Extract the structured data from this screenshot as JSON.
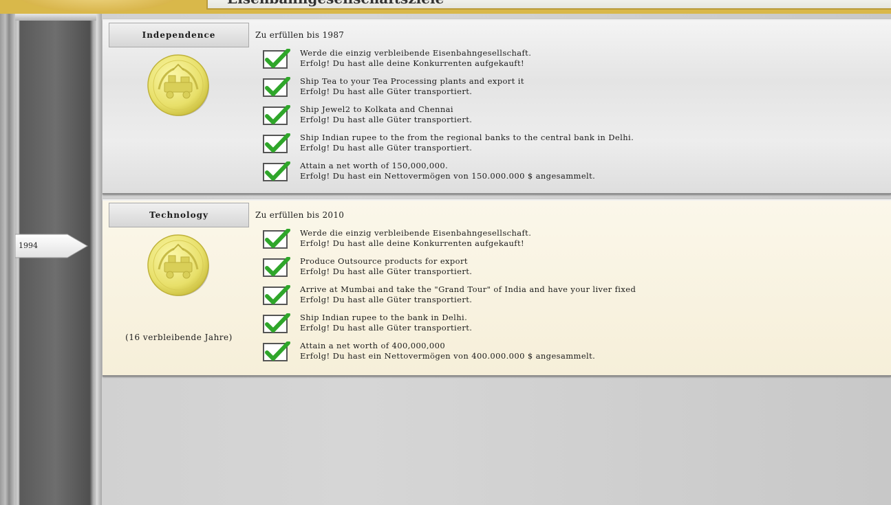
{
  "header": {
    "title": "Eisenbahngesellschaftsziele"
  },
  "timeline": {
    "current_year": "1994"
  },
  "milestones": [
    {
      "name": "Independence",
      "deadline": "Zu erfüllen bis 1987",
      "remaining": "",
      "goals": [
        {
          "title": "Werde die einzig verbleibende Eisenbahngesellschaft.",
          "status": "Erfolg! Du hast alle deine Konkurrenten aufgekauft!"
        },
        {
          "title": "Ship Tea to your Tea Processing  plants and export it",
          "status": "Erfolg! Du hast alle Güter transportiert."
        },
        {
          "title": "Ship Jewel2 to  Kolkata and Chennai",
          "status": "Erfolg! Du hast alle Güter transportiert."
        },
        {
          "title": "Ship Indian rupee to the from the regional banks to the central bank in Delhi.",
          "status": "Erfolg! Du hast alle Güter transportiert."
        },
        {
          "title": "Attain a net worth of 150,000,000.",
          "status": "Erfolg! Du hast ein Nettovermögen von 150.000.000 $ angesammelt."
        }
      ]
    },
    {
      "name": "Technology",
      "deadline": "Zu erfüllen bis 2010",
      "remaining": "(16 verbleibende Jahre)",
      "goals": [
        {
          "title": "Werde die einzig verbleibende Eisenbahngesellschaft.",
          "status": "Erfolg! Du hast alle deine Konkurrenten aufgekauft!"
        },
        {
          "title": "Produce Outsource products for export",
          "status": "Erfolg! Du hast alle Güter transportiert."
        },
        {
          "title": "Arrive at Mumbai and take the \"Grand Tour\" of India and have your liver fixed",
          "status": "Erfolg! Du hast alle Güter transportiert."
        },
        {
          "title": "Ship Indian rupee to the bank in Delhi.",
          "status": "Erfolg! Du hast alle Güter transportiert."
        },
        {
          "title": "Attain a net worth of 400,000,000",
          "status": "Erfolg! Du hast ein Nettovermögen von 400.000.000 $ angesammelt."
        }
      ]
    }
  ],
  "icons": {
    "medal": "gold-train-medal-icon",
    "check": "green-checkmark-icon"
  },
  "colors": {
    "gold": "#e8e06a",
    "check_green": "#2fa62a",
    "cream_panel": "#f7f0da"
  }
}
